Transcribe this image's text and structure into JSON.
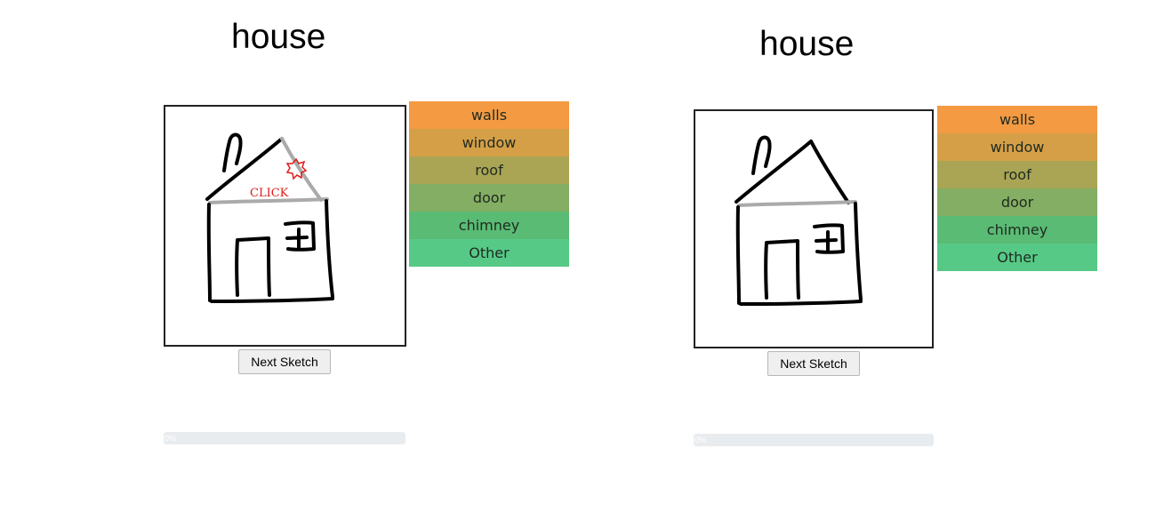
{
  "sketches": [
    {
      "title": "house",
      "labels": [
        {
          "text": "walls",
          "color": "#f39a43"
        },
        {
          "text": "window",
          "color": "#d59f47"
        },
        {
          "text": "roof",
          "color": "#a9a555"
        },
        {
          "text": "door",
          "color": "#84ae63"
        },
        {
          "text": "chimney",
          "color": "#5abb74"
        },
        {
          "text": "Other",
          "color": "#57c987"
        }
      ],
      "next_label": "Next Sketch",
      "progress_text": "0%",
      "progress_value": 0,
      "click_hint": "CLICK",
      "highlight_color": "#aaaaaa",
      "marker_color": "#e01a1a"
    },
    {
      "title": "house",
      "labels": [
        {
          "text": "walls",
          "color": "#f39a43"
        },
        {
          "text": "window",
          "color": "#d59f47"
        },
        {
          "text": "roof",
          "color": "#a9a555"
        },
        {
          "text": "door",
          "color": "#84ae63"
        },
        {
          "text": "chimney",
          "color": "#5abb74"
        },
        {
          "text": "Other",
          "color": "#57c987"
        }
      ],
      "next_label": "Next Sketch",
      "progress_text": "0%",
      "progress_value": 0,
      "highlight_color": "#aaaaaa"
    }
  ]
}
